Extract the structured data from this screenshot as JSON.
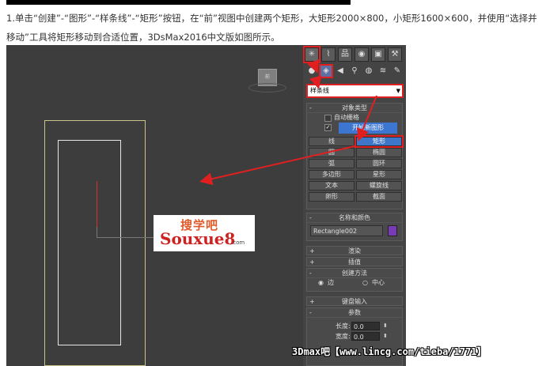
{
  "caption": "1.单击“创建”-“图形”-“样条线”-“矩形”按钮，在“前”视图中创建两个矩形，大矩形2000×800，小矩形1600×600，并使用“选择并移动”工具将矩形移动到合适位置，3DsMax2016中文版如图所示。",
  "viewcube_label": "前",
  "logo": {
    "line1": "搜学吧",
    "line2": "Souxue8",
    "line3": ".com"
  },
  "panel": {
    "tabs": [
      "✳",
      "⌇",
      "品",
      "◉",
      "▣",
      "⚒"
    ],
    "sub_tabs": [
      "●",
      "◈",
      "◀",
      "⚲",
      "◍",
      "≋",
      "✎"
    ],
    "dropdown": "样条线",
    "object_type": {
      "header": "对象类型",
      "autogrid": "自动栅格",
      "start_new_shape": "开始新图形",
      "buttons": [
        "线",
        "矩形",
        "圆",
        "椭圆",
        "弧",
        "圆环",
        "多边形",
        "星形",
        "文本",
        "螺旋线",
        "卵形",
        "截面"
      ]
    },
    "name_color": {
      "header": "名称和颜色",
      "name": "Rectangle002",
      "color": "#7a3ab8"
    },
    "render": {
      "header": "渲染"
    },
    "interp": {
      "header": "插值"
    },
    "create_method": {
      "header": "创建方法",
      "opt1": "边",
      "opt2": "中心"
    },
    "keyboard": {
      "header": "键盘输入"
    },
    "params": {
      "header": "参数",
      "length_label": "长度:",
      "length_val": "0.0",
      "width_label": "宽度:",
      "width_val": "0.0"
    }
  },
  "watermark": "3Dmax吧【www.lincg.com/tieba/1771】"
}
